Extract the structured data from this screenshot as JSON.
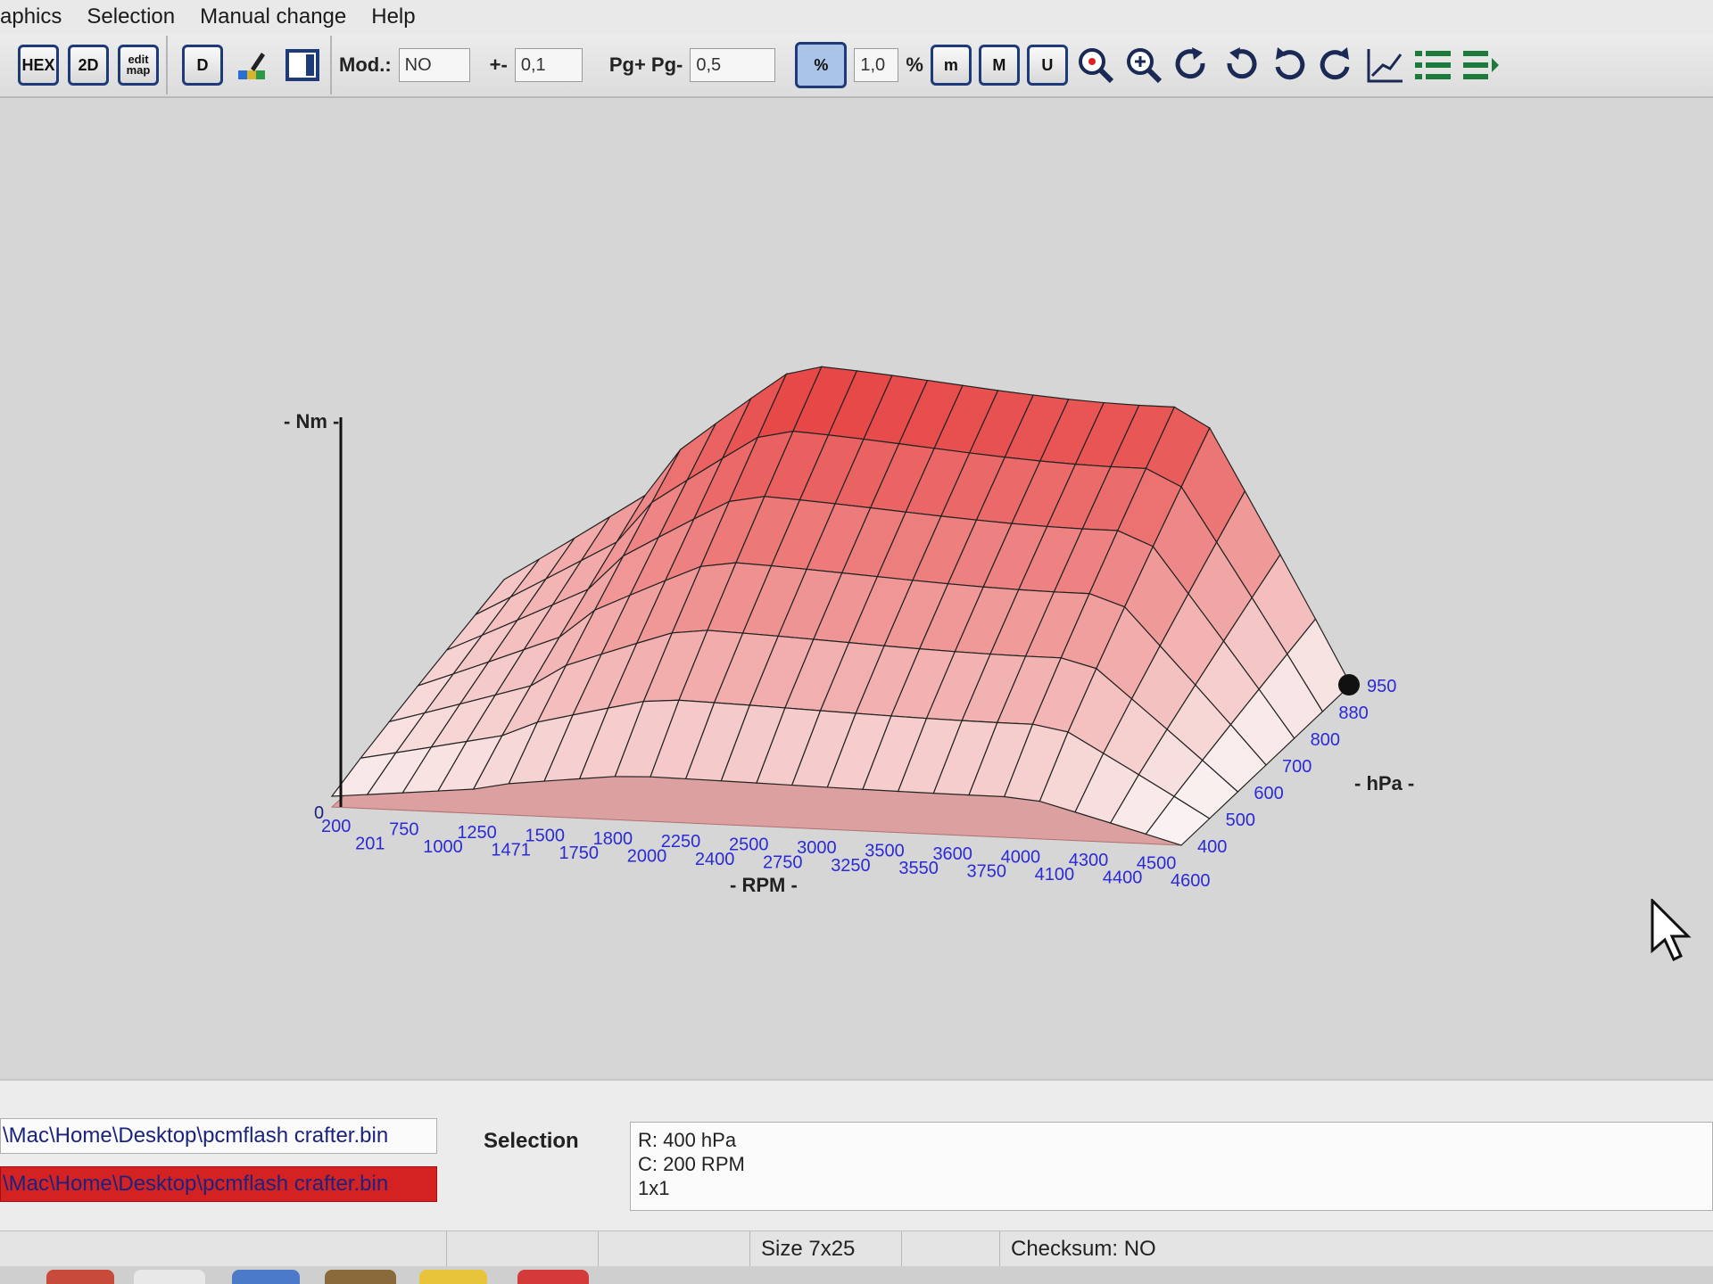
{
  "menu": [
    "aphics",
    "Selection",
    "Manual change",
    "Help"
  ],
  "toolbar": {
    "hex_label": "HEX",
    "btn_2d_label": "2D",
    "editmap_label": "edit map",
    "d_label": "D",
    "mod_label": "Mod.:",
    "mod_value": "NO",
    "plusminus_label": "+-",
    "plusminus_value": "0,1",
    "pgpg_label": "Pg+ Pg-",
    "pgpg_value": "0,5",
    "percent_btn": "%",
    "factor_value": "1,0",
    "factor_unit": "%",
    "m_label": "m",
    "M_label": "M",
    "U_label": "U"
  },
  "chart_data": {
    "type": "surface3d",
    "x_axis_label": "- RPM -",
    "y_axis_label": "- hPa -",
    "z_axis_label": "- Nm -",
    "z_origin_label": "0",
    "rpm_ticks": [
      "200",
      "201",
      "750",
      "1000",
      "1250",
      "1471",
      "1500",
      "1750",
      "1800",
      "2000",
      "2250",
      "2400",
      "2500",
      "2750",
      "3000",
      "3250",
      "3500",
      "3550",
      "3600",
      "3750",
      "4000",
      "4100",
      "4300",
      "4400",
      "4500",
      "4600"
    ],
    "hpa_ticks": [
      "400",
      "500",
      "600",
      "700",
      "800",
      "880",
      "950"
    ],
    "fill_color": "#e63c3c",
    "floor_color": "#dca0a0"
  },
  "paths": {
    "file1": "\\Mac\\Home\\Desktop\\pcmflash crafter.bin",
    "file2": "\\Mac\\Home\\Desktop\\pcmflash crafter.bin"
  },
  "selection": {
    "label": "Selection",
    "row": "R: 400 hPa",
    "col": "C: 200 RPM",
    "size": "1x1"
  },
  "status": {
    "size": "Size 7x25",
    "checksum": "Checksum: NO"
  }
}
